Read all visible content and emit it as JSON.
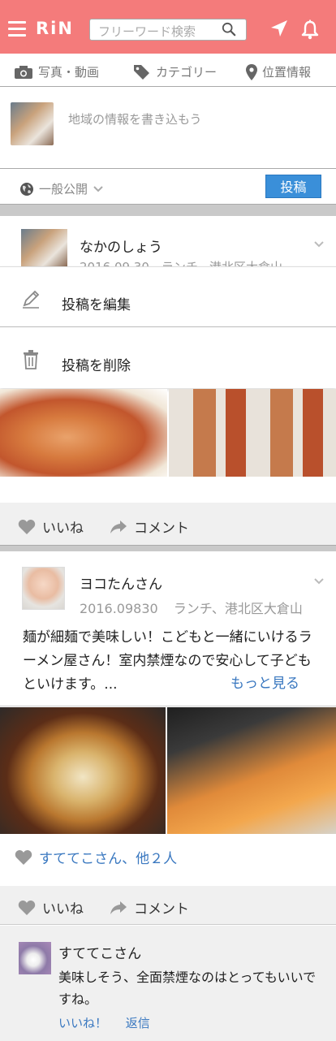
{
  "header": {
    "logo": "RiN",
    "search_placeholder": "フリーワード検索",
    "bg_color": "#f47b7b"
  },
  "composer": {
    "tools": [
      {
        "icon": "camera-icon",
        "label": "写真・動画"
      },
      {
        "icon": "tag-icon",
        "label": "カテゴリー"
      },
      {
        "icon": "location-pin-icon",
        "label": "位置情報"
      }
    ],
    "placeholder": "地域の情報を書き込もう",
    "visibility": "一般公開",
    "post_button": "投稿"
  },
  "post1": {
    "author": "なかのしょう",
    "meta": "2016.09.30　ランチ、港北区大倉山",
    "menu": {
      "edit_label": "投稿を編集",
      "delete_label": "投稿を削除"
    },
    "like_label": "いいね",
    "comment_label": "コメント"
  },
  "post2": {
    "author": "ヨコたんさん",
    "date": "2016.09830",
    "place": "ランチ、港北区大倉山",
    "body": "麺が細麺で美味しい！こどもと一緒にいけるラーメン屋さん！室内禁煙なので安心して子どもといけます。...",
    "more_link": "もっと見る",
    "likers": "すててこさん、他２人",
    "like_label": "いいね",
    "comment_label": "コメント",
    "comment": {
      "author": "すててこさん",
      "text": "美味しそう、全面禁煙なのはとってもいいですね。",
      "like_action": "いいね！",
      "reply_action": "返信"
    }
  },
  "colors": {
    "accent": "#f47b7b",
    "link": "#3a78c0",
    "button": "#3a8fd9"
  }
}
